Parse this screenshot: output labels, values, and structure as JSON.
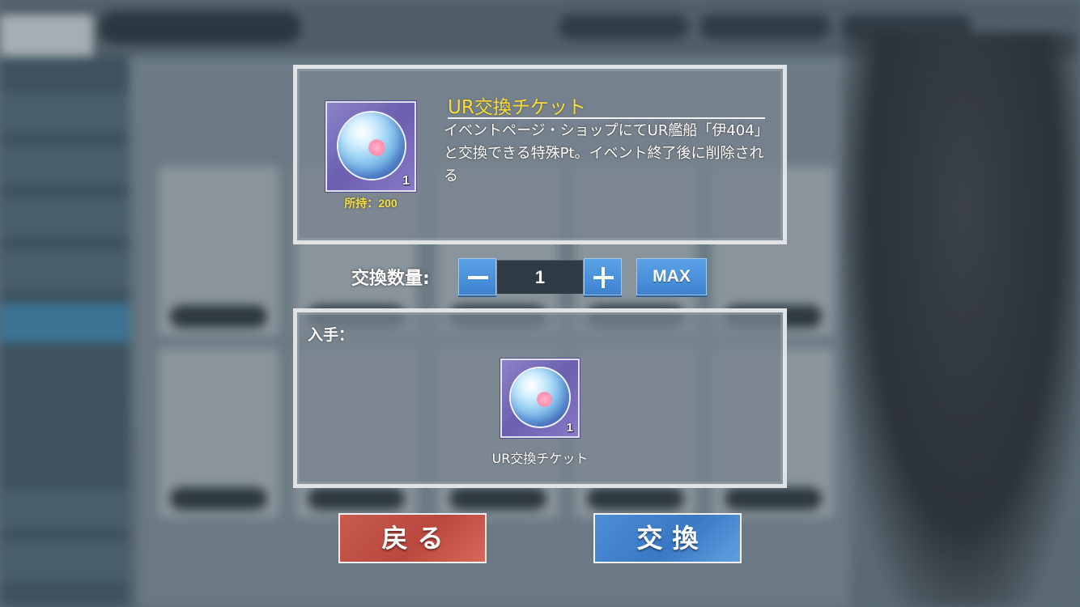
{
  "item": {
    "name": "UR交換チケット",
    "description": "イベントページ・ショップにてUR艦船「伊404」と交換できる特殊Pt。イベント終了後に削除される",
    "icon": "ur-exchange-ticket-orb-icon",
    "icon_count": "1",
    "owned_label": "所持：",
    "owned_value": "200"
  },
  "quantity": {
    "label": "交換数量:",
    "value": "1",
    "max_label": "MAX"
  },
  "gain": {
    "label": "入手：",
    "item_name": "UR交換チケット",
    "item_count": "1"
  },
  "buttons": {
    "back_label": "戻る",
    "exchange_label": "交換"
  },
  "colors": {
    "item_name": "#f7dc3a",
    "back_button": "#c85a4e",
    "exchange_button": "#3e82cf"
  }
}
